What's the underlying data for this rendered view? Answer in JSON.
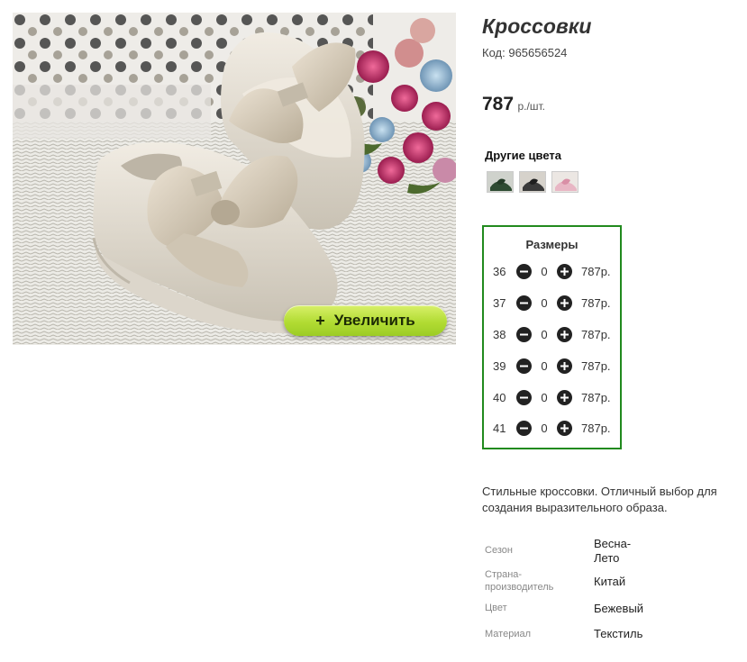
{
  "product": {
    "title": "Кроссовки",
    "code_label": "Код:",
    "code_value": "965656524",
    "price_amount": "787",
    "price_unit": "р./шт.",
    "zoom_button_label": "Увеличить",
    "zoom_button_icon": "+"
  },
  "other_colors": {
    "title": "Другие цвета",
    "swatches": [
      {
        "name": "dark-green-sneaker",
        "color": "#2e4b32"
      },
      {
        "name": "black-sneaker",
        "color": "#3a3a3a"
      },
      {
        "name": "pink-sneaker",
        "color": "#e8b6c4"
      }
    ]
  },
  "sizes": {
    "title": "Размеры",
    "rows": [
      {
        "size": "36",
        "qty": "0",
        "price": "787р."
      },
      {
        "size": "37",
        "qty": "0",
        "price": "787р."
      },
      {
        "size": "38",
        "qty": "0",
        "price": "787р."
      },
      {
        "size": "39",
        "qty": "0",
        "price": "787р."
      },
      {
        "size": "40",
        "qty": "0",
        "price": "787р."
      },
      {
        "size": "41",
        "qty": "0",
        "price": "787р."
      }
    ],
    "border_color": "#218a1e"
  },
  "description": "Стильные кроссовки. Отличный выбор для создания выразительного образа.",
  "properties": [
    {
      "label": "Сезон",
      "value": "Весна-\nЛето"
    },
    {
      "label": "Страна-\nпроизводитель",
      "value": "Китай"
    },
    {
      "label": "Цвет",
      "value": "Бежевый"
    },
    {
      "label": "Материал",
      "value": "Текстиль"
    }
  ]
}
